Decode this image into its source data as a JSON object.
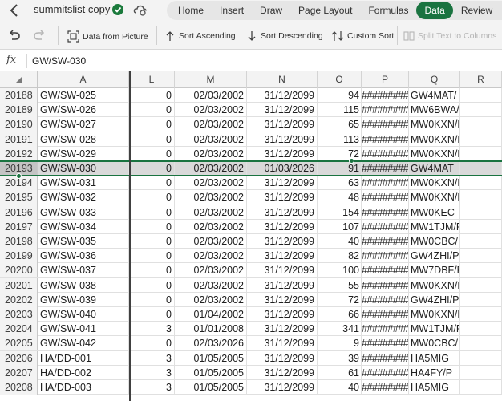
{
  "window": {
    "doc_title": "summitslist copy",
    "tabs": [
      {
        "label": "Home",
        "active": false
      },
      {
        "label": "Insert",
        "active": false
      },
      {
        "label": "Draw",
        "active": false
      },
      {
        "label": "Page Layout",
        "active": false
      },
      {
        "label": "Formulas",
        "active": false
      },
      {
        "label": "Data",
        "active": true
      },
      {
        "label": "Review",
        "active": false
      }
    ]
  },
  "ribbon": {
    "data_from_picture": "Data from Picture",
    "sort_ascending": "Sort Ascending",
    "sort_descending": "Sort Descending",
    "custom_sort": "Custom Sort",
    "split_text": "Split Text to Columns"
  },
  "formula_bar": {
    "fx_label": "fx",
    "value": "GW/SW-030"
  },
  "colors": {
    "accent": "#1a7340",
    "header_bg": "#f3f3f3",
    "selected_row_bg": "#d9d9d9"
  },
  "grid": {
    "columns": [
      "A",
      "L",
      "M",
      "N",
      "O",
      "P",
      "Q",
      "R"
    ],
    "selected_row": 5,
    "rows": [
      {
        "num": "20188",
        "A": "GW/SW-025",
        "L": "0",
        "M": "02/03/2002",
        "N": "31/12/2099",
        "O": "94",
        "P": "##########",
        "Q": "GW4MAT/ P"
      },
      {
        "num": "20189",
        "A": "GW/SW-026",
        "L": "0",
        "M": "02/03/2002",
        "N": "31/12/2099",
        "O": "115",
        "P": "##########",
        "Q": "MW6BWA/P"
      },
      {
        "num": "20190",
        "A": "GW/SW-027",
        "L": "0",
        "M": "02/03/2002",
        "N": "31/12/2099",
        "O": "65",
        "P": "##########",
        "Q": "MW0KXN/P"
      },
      {
        "num": "20191",
        "A": "GW/SW-028",
        "L": "0",
        "M": "02/03/2002",
        "N": "31/12/2099",
        "O": "113",
        "P": "##########",
        "Q": "MW0KXN/P"
      },
      {
        "num": "20192",
        "A": "GW/SW-029",
        "L": "0",
        "M": "02/03/2002",
        "N": "31/12/2099",
        "O": "72",
        "P": "##########",
        "Q": "MW0KXN/P"
      },
      {
        "num": "20193",
        "A": "GW/SW-030",
        "L": "0",
        "M": "02/03/2002",
        "N": "01/03/2026",
        "O": "91",
        "P": "##########",
        "Q": "GW4MAT"
      },
      {
        "num": "20194",
        "A": "GW/SW-031",
        "L": "0",
        "M": "02/03/2002",
        "N": "31/12/2099",
        "O": "63",
        "P": "##########",
        "Q": "MW0KXN/P"
      },
      {
        "num": "20195",
        "A": "GW/SW-032",
        "L": "0",
        "M": "02/03/2002",
        "N": "31/12/2099",
        "O": "48",
        "P": "##########",
        "Q": "MW0KXN/P"
      },
      {
        "num": "20196",
        "A": "GW/SW-033",
        "L": "0",
        "M": "02/03/2002",
        "N": "31/12/2099",
        "O": "154",
        "P": "##########",
        "Q": "MW0KEC"
      },
      {
        "num": "20197",
        "A": "GW/SW-034",
        "L": "0",
        "M": "02/03/2002",
        "N": "31/12/2099",
        "O": "107",
        "P": "##########",
        "Q": "MW1TJM/P"
      },
      {
        "num": "20198",
        "A": "GW/SW-035",
        "L": "0",
        "M": "02/03/2002",
        "N": "31/12/2099",
        "O": "40",
        "P": "##########",
        "Q": "MW0CBC/P"
      },
      {
        "num": "20199",
        "A": "GW/SW-036",
        "L": "0",
        "M": "02/03/2002",
        "N": "31/12/2099",
        "O": "82",
        "P": "##########",
        "Q": "GW4ZHI/P"
      },
      {
        "num": "20200",
        "A": "GW/SW-037",
        "L": "0",
        "M": "02/03/2002",
        "N": "31/12/2099",
        "O": "100",
        "P": "##########",
        "Q": "MW7DBF/P"
      },
      {
        "num": "20201",
        "A": "GW/SW-038",
        "L": "0",
        "M": "02/03/2002",
        "N": "31/12/2099",
        "O": "55",
        "P": "##########",
        "Q": "MW0KXN/P"
      },
      {
        "num": "20202",
        "A": "GW/SW-039",
        "L": "0",
        "M": "02/03/2002",
        "N": "31/12/2099",
        "O": "72",
        "P": "##########",
        "Q": "GW4ZHI/P"
      },
      {
        "num": "20203",
        "A": "GW/SW-040",
        "L": "0",
        "M": "01/04/2002",
        "N": "31/12/2099",
        "O": "66",
        "P": "##########",
        "Q": "MW0KXN/P"
      },
      {
        "num": "20204",
        "A": "GW/SW-041",
        "L": "3",
        "M": "01/01/2008",
        "N": "31/12/2099",
        "O": "341",
        "P": "##########",
        "Q": "MW1TJM/P"
      },
      {
        "num": "20205",
        "A": "GW/SW-042",
        "L": "0",
        "M": "02/03/2026",
        "N": "31/12/2099",
        "O": "9",
        "P": "##########",
        "Q": "MW0CBC/P"
      },
      {
        "num": "20206",
        "A": "HA/DD-001",
        "L": "3",
        "M": "01/05/2005",
        "N": "31/12/2099",
        "O": "39",
        "P": "##########",
        "Q": "HA5MIG"
      },
      {
        "num": "20207",
        "A": "HA/DD-002",
        "L": "3",
        "M": "01/05/2005",
        "N": "31/12/2099",
        "O": "61",
        "P": "##########",
        "Q": "HA4FY/P"
      },
      {
        "num": "20208",
        "A": "HA/DD-003",
        "L": "3",
        "M": "01/05/2005",
        "N": "31/12/2099",
        "O": "40",
        "P": "##########",
        "Q": "HA5MIG"
      }
    ]
  }
}
